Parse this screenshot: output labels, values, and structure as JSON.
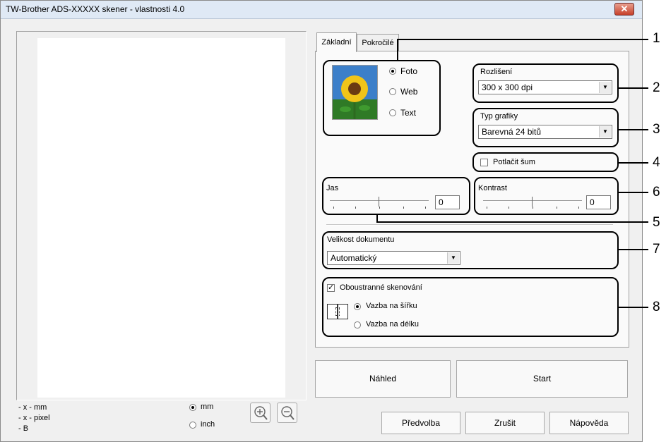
{
  "window": {
    "title": "TW-Brother ADS-XXXXX skener - vlastnosti 4.0",
    "close_symbol": "✕"
  },
  "preview_info": {
    "line1": "- x - mm",
    "line2": "- x - pixel",
    "line3": "- B",
    "unit_mm": "mm",
    "unit_inch": "inch",
    "selected_unit": "mm"
  },
  "tabs": [
    {
      "label": "Základní",
      "active": true
    },
    {
      "label": "Pokročilé",
      "active": false
    }
  ],
  "image_type": {
    "options": [
      "Foto",
      "Web",
      "Text"
    ],
    "selected": "Foto"
  },
  "resolution": {
    "label": "Rozlišení",
    "value": "300 x 300 dpi"
  },
  "graphics_type": {
    "label": "Typ grafiky",
    "value": "Barevná 24 bitů"
  },
  "noise": {
    "label": "Potlačit šum",
    "checked": false
  },
  "brightness": {
    "label": "Jas",
    "value": "0"
  },
  "contrast": {
    "label": "Kontrast",
    "value": "0"
  },
  "document_size": {
    "label": "Velikost dokumentu",
    "value": "Automatický"
  },
  "duplex": {
    "label": "Oboustranné skenování",
    "checked": true,
    "option_width": "Vazba na šířku",
    "option_length": "Vazba na délku",
    "selected": "Vazba na šířku"
  },
  "buttons": {
    "preview": "Náhled",
    "start": "Start",
    "preset": "Předvolba",
    "cancel": "Zrušit",
    "help": "Nápověda"
  },
  "callouts": [
    "1",
    "2",
    "3",
    "4",
    "5",
    "6",
    "7",
    "8"
  ]
}
